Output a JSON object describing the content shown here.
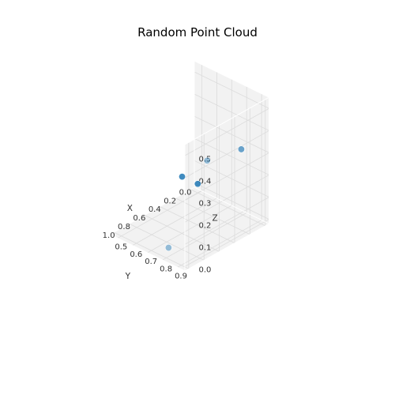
{
  "chart_data": {
    "type": "scatter",
    "title": "Random Point Cloud",
    "xlabel": "X",
    "ylabel": "Y",
    "zlabel": "Z",
    "x_ticks": [
      "0.0",
      "0.2",
      "0.4",
      "0.6",
      "0.8",
      "1.0"
    ],
    "y_ticks": [
      "0.5",
      "0.6",
      "0.7",
      "0.8",
      "0.9"
    ],
    "z_ticks": [
      "0.0",
      "0.1",
      "0.2",
      "0.3",
      "0.4",
      "0.5"
    ],
    "xlim": [
      -0.05,
      1.05
    ],
    "ylim": [
      0.45,
      0.95
    ],
    "zlim": [
      -0.02,
      0.55
    ],
    "points": [
      {
        "x": 0.5,
        "y": 0.65,
        "z": 0.2,
        "alpha": 0.85
      },
      {
        "x": 0.55,
        "y": 0.78,
        "z": 0.22,
        "alpha": 0.85
      },
      {
        "x": 0.7,
        "y": 0.92,
        "z": 0.4,
        "alpha": 0.45
      },
      {
        "x": 0.02,
        "y": 0.8,
        "z": 0.28,
        "alpha": 0.65
      },
      {
        "x": 0.97,
        "y": 0.8,
        "z": 0.02,
        "alpha": 0.45
      }
    ],
    "point_color": "#1f77b4"
  }
}
